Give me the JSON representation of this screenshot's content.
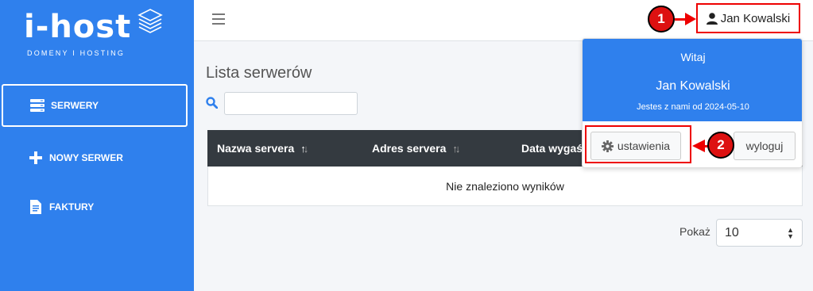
{
  "brand": {
    "name": "i-host",
    "tagline": "DOMENY I HOSTING"
  },
  "sidebar": {
    "items": [
      {
        "label": "SERWERY",
        "icon": "server-icon",
        "active": true
      },
      {
        "label": "NOWY SERWER",
        "icon": "plus-icon",
        "active": false
      },
      {
        "label": "FAKTURY",
        "icon": "invoice-icon",
        "active": false
      }
    ]
  },
  "topbar": {
    "user_label": "Jan Kowalski"
  },
  "main": {
    "title": "Lista serwerów",
    "search": {
      "value": "",
      "placeholder": ""
    },
    "table": {
      "columns": [
        "Nazwa servera",
        "Adres servera",
        "Data wygaśnięcia"
      ],
      "empty_text": "Nie znaleziono wyników"
    },
    "pagination": {
      "show_label": "Pokaż",
      "page_size": "10"
    }
  },
  "dropdown": {
    "greeting": "Witaj",
    "name": "Jan Kowalski",
    "since": "Jestes z nami od 2024-05-10",
    "settings_label": "ustawienia",
    "logout_label": "wyloguj"
  },
  "callouts": [
    "1",
    "2"
  ],
  "colors": {
    "sidebar": "#2f80ed",
    "accent": "#2f80ed",
    "highlight": "#ee0000",
    "table_header": "#343a40"
  }
}
